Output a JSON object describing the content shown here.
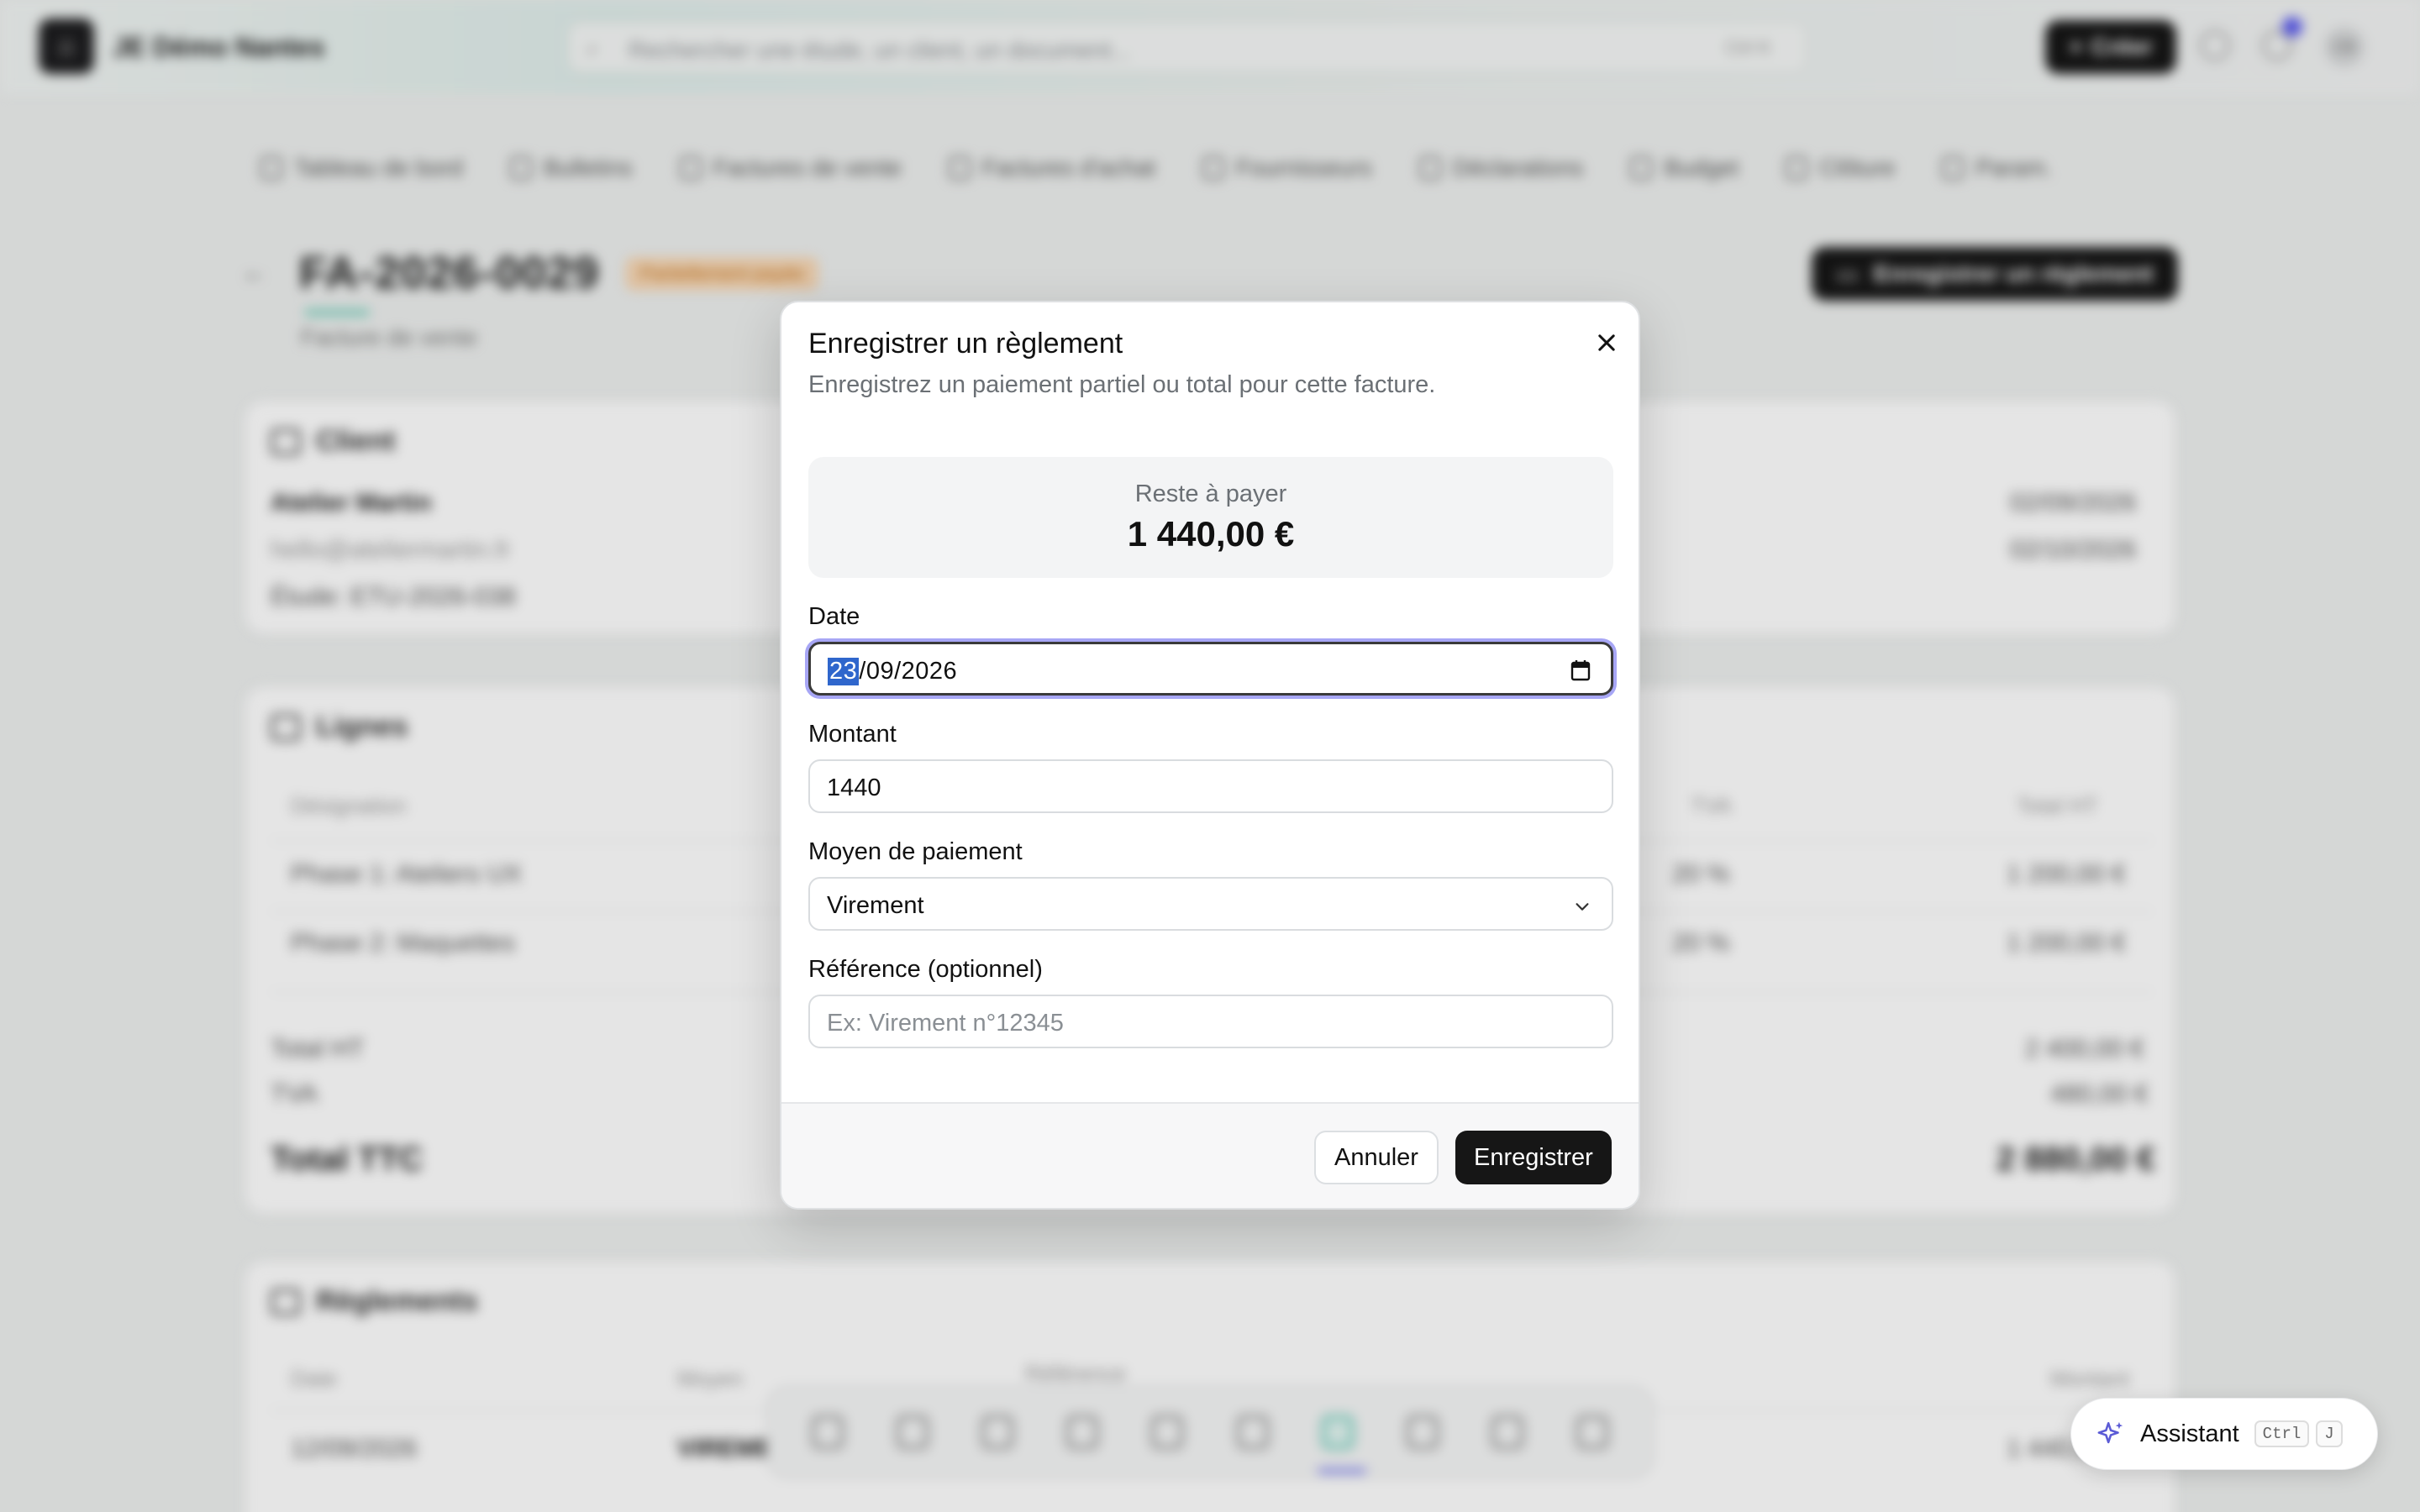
{
  "app": {
    "logo_glyph": "⌂",
    "name": "JE Démo Nantes",
    "search_placeholder": "Rechercher une étude, un client, un document...",
    "search_shortcut": "Ctrl K",
    "create_label": "Créer",
    "avatar_initials": "CB"
  },
  "nav": {
    "items": [
      {
        "label": "Tableau de bord"
      },
      {
        "label": "Bulletins"
      },
      {
        "label": "Factures de vente"
      },
      {
        "label": "Factures d'achat"
      },
      {
        "label": "Fournisseurs"
      },
      {
        "label": "Déclarations"
      },
      {
        "label": "Budget"
      },
      {
        "label": "Clôture"
      },
      {
        "label": "Param."
      }
    ]
  },
  "invoice": {
    "back_glyph": "←",
    "number": "FA-2026-0029",
    "status_badge": "Partiellement payée",
    "subtitle": "Facture de vente",
    "record_payment_label": "Enregistrer un règlement"
  },
  "client_card": {
    "title": "Client",
    "name": "Atelier Martin",
    "email": "hello@ateliermartin.fr",
    "study": "Étude: ETU-2026-038",
    "date1": "02/09/2026",
    "date2": "02/10/2026"
  },
  "lines_card": {
    "title": "Lignes",
    "headers": {
      "designation": "Désignation",
      "tva": "TVA",
      "total_ht": "Total HT"
    },
    "rows": [
      {
        "designation": "Phase 1: Ateliers UX",
        "tva": "20 %",
        "total_ht": "1 200,00 €"
      },
      {
        "designation": "Phase 2: Maquettes",
        "tva": "20 %",
        "total_ht": "1 200,00 €"
      }
    ],
    "total_ht_label": "Total HT",
    "total_ht_value": "2 400,00 €",
    "tva_label": "TVA",
    "tva_value": "480,00 €",
    "total_ttc_label": "Total TTC",
    "total_ttc_value": "2 880,00 €"
  },
  "payments_card": {
    "title": "Règlements",
    "headers": {
      "date": "Date",
      "means": "Moyen",
      "reference": "Référence",
      "amount": "Montant"
    },
    "row": {
      "date": "12/09/2026",
      "means": "VIREME",
      "amount": "1 440,00 €"
    }
  },
  "modal": {
    "title": "Enregistrer un règlement",
    "description": "Enregistrez un paiement partiel ou total pour cette facture.",
    "remaining_label": "Reste à payer",
    "remaining_amount": "1 440,00 €",
    "date_label": "Date",
    "date_day": "23",
    "date_rest": "/09/2026",
    "amount_label": "Montant",
    "amount_value": "1440",
    "method_label": "Moyen de paiement",
    "method_value": "Virement",
    "reference_label": "Référence (optionnel)",
    "reference_placeholder": "Ex: Virement n°12345",
    "cancel_label": "Annuler",
    "save_label": "Enregistrer"
  },
  "assistant": {
    "label": "Assistant",
    "key1": "Ctrl",
    "key2": "J"
  },
  "colors": {
    "primary_dark": "#161616",
    "focus_ring": "#a7a6f5",
    "selection": "#2f66cc",
    "accent_teal": "#7ed3c0",
    "assistant_sparkle": "#5b5bd6"
  }
}
